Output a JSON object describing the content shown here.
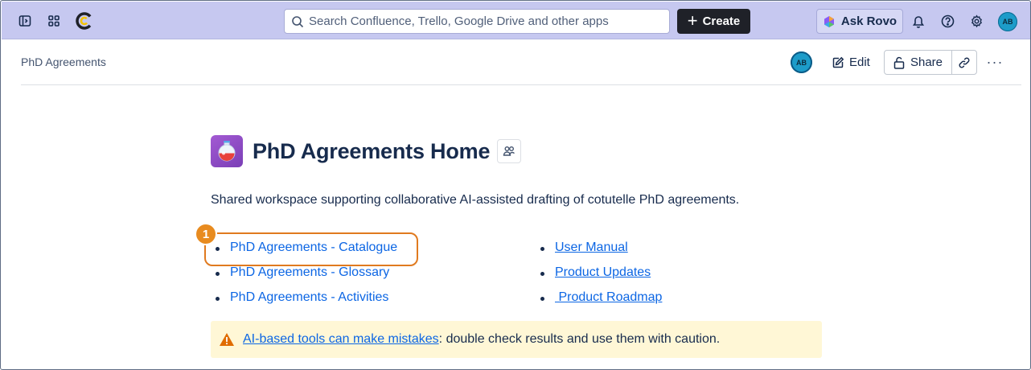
{
  "topnav": {
    "search_placeholder": "Search Confluence, Trello, Google Drive and other apps",
    "create_label": "Create",
    "rovo_label": "Ask Rovo",
    "avatar_initials": "AB"
  },
  "page_header": {
    "breadcrumb": "PhD Agreements",
    "avatar_initials": "AB",
    "edit_label": "Edit",
    "share_label": "Share",
    "more_label": "···"
  },
  "content": {
    "title": "PhD Agreements Home",
    "intro": "Shared workspace supporting collaborative AI-assisted drafting of cotutelle PhD agreements.",
    "left_links": [
      {
        "label": "PhD Agreements - Catalogue"
      },
      {
        "label": "PhD Agreements - Glossary"
      },
      {
        "label": "PhD Agreements - Activities"
      }
    ],
    "right_links": [
      {
        "label": "User Manual"
      },
      {
        "label": "Product Updates"
      },
      {
        "label": " Product Roadmap"
      }
    ],
    "step_badge": "1",
    "warning": {
      "link_text": "AI-based tools can make mistakes",
      "rest_text": ": double check results and use them with caution."
    }
  },
  "colors": {
    "topnav_bg": "#c6c8f0",
    "link": "#0c66e4",
    "highlight": "#e07a1f",
    "warning_bg": "#fff7d6"
  }
}
